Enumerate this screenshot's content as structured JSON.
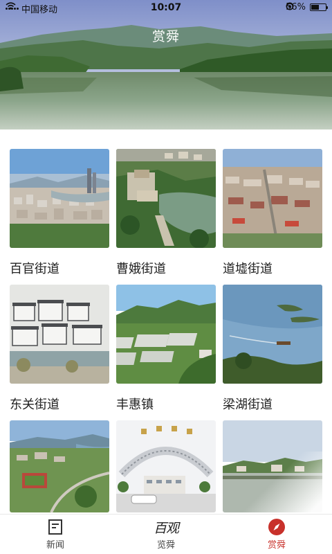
{
  "status_bar": {
    "carrier": "中国移动",
    "time": "10:07",
    "battery_pct": "56%",
    "battery_level": 0.56
  },
  "header": {
    "title": "赏舜"
  },
  "districts": [
    {
      "name": "百官街道"
    },
    {
      "name": "曹娥街道"
    },
    {
      "name": "道墟街道"
    },
    {
      "name": "东关街道"
    },
    {
      "name": "丰惠镇"
    },
    {
      "name": "梁湖街道"
    }
  ],
  "tabs": [
    {
      "label": "新闻",
      "icon": "news-icon"
    },
    {
      "label": "览舜",
      "icon": "calligraphy-logo",
      "logo_text": "百观"
    },
    {
      "label": "赏舜",
      "icon": "compass-icon",
      "active": true
    }
  ],
  "colors": {
    "accent": "#c8312b"
  }
}
